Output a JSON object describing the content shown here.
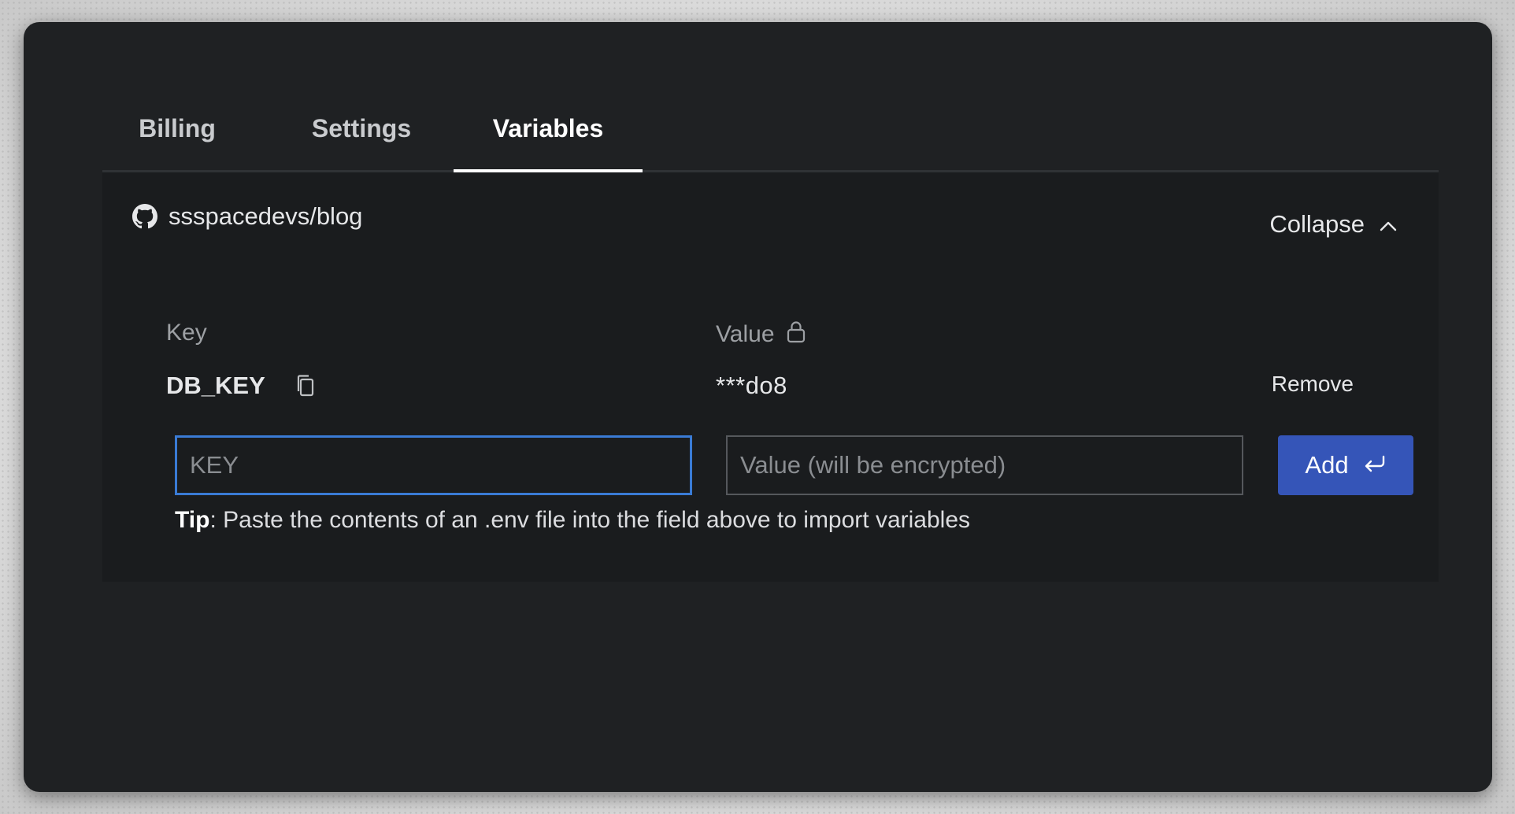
{
  "tabs": [
    {
      "label": "Billing",
      "active": false
    },
    {
      "label": "Settings",
      "active": false
    },
    {
      "label": "Variables",
      "active": true
    }
  ],
  "repo": {
    "icon": "github-icon",
    "name": "ssspacedevs/blog"
  },
  "collapse": {
    "label": "Collapse",
    "icon": "chevron-up-icon"
  },
  "columns": {
    "key": "Key",
    "value": "Value",
    "value_icon": "lock-icon"
  },
  "variables": [
    {
      "key": "DB_KEY",
      "value": "***do8",
      "remove_label": "Remove",
      "copy_icon": "copy-icon"
    }
  ],
  "form": {
    "key_placeholder": "KEY",
    "value_placeholder": "Value (will be encrypted)",
    "add_label": "Add",
    "add_icon": "enter-return-icon"
  },
  "tip": {
    "label": "Tip",
    "text": ": Paste the contents of an .env file into the field above to import variables"
  },
  "colors": {
    "window_bg": "#1f2123",
    "panel_bg": "#1a1c1e",
    "accent_focus": "#3a7bd5",
    "add_button": "#3555b8"
  }
}
